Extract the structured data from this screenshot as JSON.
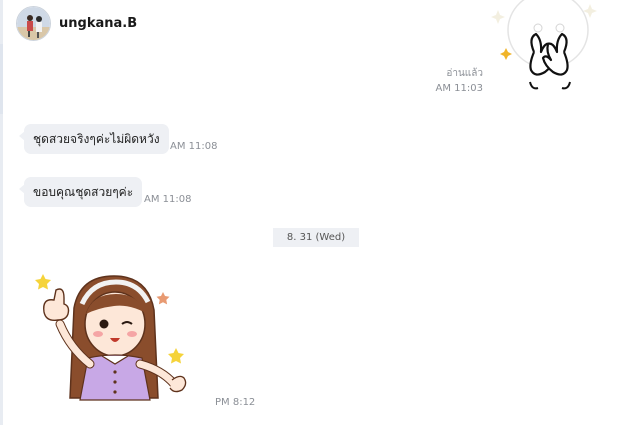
{
  "header": {
    "contact_name": "ungkana.B"
  },
  "outgoing_sticker": {
    "read_label": "อ่านแล้ว",
    "time": "AM 11:03"
  },
  "messages": [
    {
      "text": "ชุดสวยจริงๆค่ะไม่ผิดหวัง",
      "time": "AM 11:08"
    },
    {
      "text": "ขอบคุณชุดสวยๆค่ะ",
      "time": "AM 11:08"
    }
  ],
  "date_separator": "8. 31 (Wed)",
  "incoming_sticker": {
    "time": "PM 8:12"
  }
}
